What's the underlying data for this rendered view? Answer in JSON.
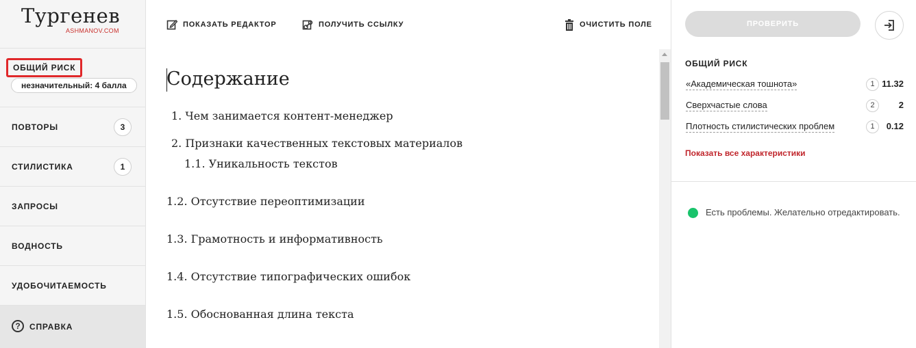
{
  "app": {
    "title": "Тургенев",
    "subtitle": "ASHMANOV.COM"
  },
  "sidebar": {
    "risk_label": "ОБЩИЙ РИСК",
    "risk_value": "незначительный: 4 балла",
    "items": [
      {
        "label": "ПОВТОРЫ",
        "count": "3"
      },
      {
        "label": "СТИЛИСТИКА",
        "count": "1"
      },
      {
        "label": "ЗАПРОСЫ"
      },
      {
        "label": "ВОДНОСТЬ"
      },
      {
        "label": "УДОБОЧИТАЕМОСТЬ"
      }
    ],
    "help_label": "СПРАВКА"
  },
  "toolbar": {
    "show_editor": "ПОКАЗАТЬ РЕДАКТОР",
    "get_link": "ПОЛУЧИТЬ ССЫЛКУ",
    "clear_field": "ОЧИСТИТЬ ПОЛЕ"
  },
  "document": {
    "heading": "Содержание",
    "lines": [
      "1. Чем занимается контент-менеджер",
      "2. Признаки качественных текстовых материалов",
      "1.1. Уникальность текстов",
      "1.2. Отсутствие переоптимизации",
      "1.3. Грамотность и информативность",
      "1.4. Отсутствие типографических ошибок",
      "1.5. Обоснованная длина текста"
    ]
  },
  "right_panel": {
    "check_label": "ПРОВЕРИТЬ",
    "title": "ОБЩИЙ РИСК",
    "metrics": [
      {
        "name": "«Академическая тошнота»",
        "score": "1",
        "value": "11.32"
      },
      {
        "name": "Сверхчастые слова",
        "score": "2",
        "value": "2"
      },
      {
        "name": "Плотность стилистических проблем",
        "score": "1",
        "value": "0.12"
      }
    ],
    "show_all": "Показать все характеристики",
    "status": "Есть проблемы. Желательно отредактировать.",
    "status_color": "#19c36b"
  },
  "colors": {
    "accent_red": "#c0262c",
    "highlight_red": "#e0282a",
    "status_green": "#19c36b"
  },
  "icons": [
    "edit-icon",
    "link-icon",
    "trash-icon",
    "help-icon",
    "exit-icon"
  ]
}
